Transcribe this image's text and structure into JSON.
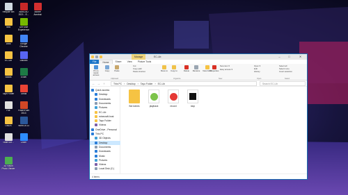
{
  "desktop": {
    "icons": [
      {
        "label": "Recycle Bin",
        "icon": "recycle-bin-icon",
        "color": "#cfd8e3"
      },
      {
        "label": "AutoCAD 2021 - E...",
        "icon": "autocad-icon",
        "color": "#c62828"
      },
      {
        "label": "Adobe Acrobat",
        "icon": "acrobat-icon",
        "color": "#d32f2f"
      },
      {
        "label": "next",
        "icon": "folder-icon",
        "color": "#f6c343"
      },
      {
        "label": "GeForce Experience",
        "icon": "geforce-icon",
        "color": "#76b900"
      },
      {
        "label": "1666",
        "icon": "folder-icon",
        "color": "#f6c343"
      },
      {
        "label": "Google Chrome",
        "icon": "chrome-icon",
        "color": "#4285f4"
      },
      {
        "label": "EC-Lib",
        "icon": "folder-icon",
        "color": "#f6c343"
      },
      {
        "label": "Discord",
        "icon": "discord-icon",
        "color": "#5865f2"
      },
      {
        "label": "Books",
        "icon": "folder-icon",
        "color": "#f6c343"
      },
      {
        "label": "Excel",
        "icon": "excel-icon",
        "color": "#1d7a45"
      },
      {
        "label": "Tayo Folder",
        "icon": "folder-icon",
        "color": "#f6c343"
      },
      {
        "label": "Gmail",
        "icon": "gmail-icon",
        "color": "#ea4335"
      },
      {
        "label": "File",
        "icon": "file-icon",
        "color": "#e0e0e0"
      },
      {
        "label": "PowerPoint 2013",
        "icon": "powerpoint-icon",
        "color": "#d24726"
      },
      {
        "label": "ONUS",
        "icon": "folder-icon",
        "color": "#f6c343"
      },
      {
        "label": "Word 2013",
        "icon": "word-icon",
        "color": "#2b579a"
      },
      {
        "label": "Swift Sof...",
        "icon": "app-icon",
        "color": "#e0e0e0"
      },
      {
        "label": "Zoom",
        "icon": "zoom-icon",
        "color": "#2d8cff"
      },
      {
        "label": "3D Vision Photo Viewer",
        "icon": "viewer-icon",
        "color": "#4caf50"
      }
    ]
  },
  "window": {
    "title": "EC-Lib",
    "manage_tab": "Manage",
    "controls": {
      "minimize": "–",
      "maximize": "□",
      "close": "✕"
    },
    "menu": [
      "File",
      "Home",
      "Share",
      "View",
      "Picture Tools"
    ],
    "ribbon": {
      "buttons": [
        {
          "label": "Pin to Quick access",
          "icon": "pin-icon",
          "color": "#4a90d9"
        },
        {
          "label": "Copy",
          "icon": "copy-icon",
          "color": "#7aa7d6"
        },
        {
          "label": "Paste",
          "icon": "paste-icon",
          "color": "#c8a76a"
        },
        {
          "label": "Move to",
          "icon": "move-icon",
          "color": "#f0c24a"
        },
        {
          "label": "Copy to",
          "icon": "copyto-icon",
          "color": "#f0c24a"
        },
        {
          "label": "Delete",
          "icon": "delete-icon",
          "color": "#d93025"
        },
        {
          "label": "Rename",
          "icon": "rename-icon",
          "color": "#9aa5b1"
        },
        {
          "label": "New folder",
          "icon": "new-folder-icon",
          "color": "#f6c343"
        },
        {
          "label": "Properties",
          "icon": "properties-icon",
          "color": "#d93025"
        }
      ],
      "small": {
        "cut": "Cut",
        "copy_path": "Copy path",
        "paste_shortcut": "Paste shortcut",
        "new_item": "New item ▾",
        "easy_access": "Easy access ▾",
        "open": "Open ▾",
        "edit": "Edit",
        "history": "History",
        "select_all": "Select all",
        "select_none": "Select none",
        "invert_selection": "Invert selection"
      },
      "groups": [
        "Clipboard",
        "Organize",
        "New",
        "Open",
        "Select"
      ]
    },
    "address": {
      "back": "←",
      "forward": "→",
      "up": "↑",
      "path": [
        "This PC",
        "Desktop",
        "Tayo Folder",
        "EC-Lib"
      ],
      "search_placeholder": "Search EC-Lib"
    },
    "nav": [
      {
        "label": "Quick access",
        "icon": "star-icon",
        "color": "#2a7dd8",
        "sel": false
      },
      {
        "label": "Desktop",
        "icon": "desktop-icon",
        "color": "#2a7dd8",
        "sel": false
      },
      {
        "label": "Downloads",
        "icon": "download-icon",
        "color": "#2a7dd8",
        "sel": false
      },
      {
        "label": "Documents",
        "icon": "document-icon",
        "color": "#8a9bb0",
        "sel": false
      },
      {
        "label": "Pictures",
        "icon": "pictures-icon",
        "color": "#3fa0d8",
        "sel": false
      },
      {
        "label": "EC-Lib",
        "icon": "folder-icon",
        "color": "#f6c343",
        "sel": false
      },
      {
        "label": "minecraft-host",
        "icon": "folder-icon",
        "color": "#f6c343",
        "sel": false
      },
      {
        "label": "Tayo Folder",
        "icon": "folder-icon",
        "color": "#f6c343",
        "sel": false
      },
      {
        "label": "Videos",
        "icon": "video-icon",
        "color": "#7b5ea7",
        "sel": false
      },
      {
        "label": "OneDrive - Personal",
        "icon": "onedrive-icon",
        "color": "#2a7dd8",
        "sel": false
      },
      {
        "label": "This PC",
        "icon": "pc-icon",
        "color": "#2a7dd8",
        "sel": false
      },
      {
        "label": "3D Objects",
        "icon": "cube-icon",
        "color": "#3fa0d8",
        "sel": false
      },
      {
        "label": "Desktop",
        "icon": "desktop-icon",
        "color": "#2a7dd8",
        "sel": true
      },
      {
        "label": "Documents",
        "icon": "document-icon",
        "color": "#8a9bb0",
        "sel": false
      },
      {
        "label": "Downloads",
        "icon": "download-icon",
        "color": "#2a7dd8",
        "sel": false
      },
      {
        "label": "Music",
        "icon": "music-icon",
        "color": "#2a7dd8",
        "sel": false
      },
      {
        "label": "Pictures",
        "icon": "pictures-icon",
        "color": "#3fa0d8",
        "sel": false
      },
      {
        "label": "Videos",
        "icon": "video-icon",
        "color": "#7b5ea7",
        "sel": false
      },
      {
        "label": "Local Disk (C:)",
        "icon": "disk-icon",
        "color": "#8a9bb0",
        "sel": false
      }
    ],
    "files": [
      {
        "name": "Bot Icenes",
        "icon": "folder-icon",
        "color": "#f6c343"
      },
      {
        "name": "playback",
        "icon": "play-icon",
        "color": "#7cc34a"
      },
      {
        "name": "record",
        "icon": "record-icon",
        "color": "#e53935"
      },
      {
        "name": "stop",
        "icon": "stop-icon",
        "color": "#111111"
      }
    ],
    "status": "4 items"
  }
}
